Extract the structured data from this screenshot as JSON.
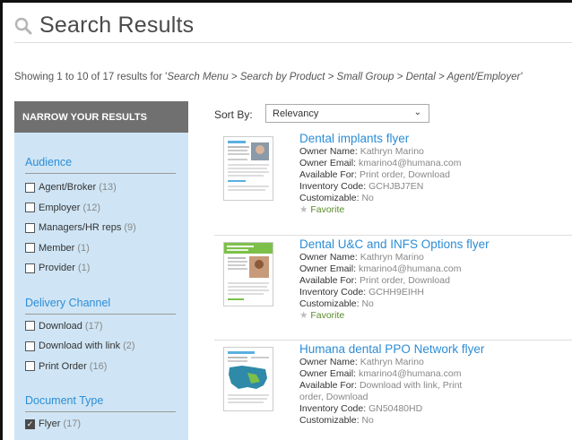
{
  "header": {
    "title": "Search Results"
  },
  "results_summary": {
    "prefix": "Showing 1 to 10 of 17 results for '",
    "crumb": "Search Menu > Search by Product > Small Group > Dental > Agent/Employer'"
  },
  "sidebar": {
    "heading": "NARROW YOUR RESULTS",
    "groups": [
      {
        "title": "Audience",
        "items": [
          {
            "label": "Agent/Broker",
            "count": "(13)",
            "checked": false
          },
          {
            "label": "Employer",
            "count": "(12)",
            "checked": false
          },
          {
            "label": "Managers/HR reps",
            "count": "(9)",
            "checked": false
          },
          {
            "label": "Member",
            "count": "(1)",
            "checked": false
          },
          {
            "label": "Provider",
            "count": "(1)",
            "checked": false
          }
        ]
      },
      {
        "title": "Delivery Channel",
        "items": [
          {
            "label": "Download",
            "count": "(17)",
            "checked": false
          },
          {
            "label": "Download with link",
            "count": "(2)",
            "checked": false
          },
          {
            "label": "Print Order",
            "count": "(16)",
            "checked": false
          }
        ]
      },
      {
        "title": "Document Type",
        "items": [
          {
            "label": "Flyer",
            "count": "(17)",
            "checked": true
          }
        ]
      }
    ]
  },
  "sort": {
    "label": "Sort By:",
    "selected": "Relevancy"
  },
  "results": [
    {
      "title": "Dental implants flyer",
      "owner_name_label": "Owner Name:",
      "owner_name": "Kathryn Marino",
      "owner_email_label": "Owner Email:",
      "owner_email": "kmarino4@humana.com",
      "available_label": "Available For:",
      "available": "Print order, Download",
      "available2": "",
      "inventory_label": "Inventory Code:",
      "inventory": "GCHJBJ7EN",
      "custom_label": "Customizable:",
      "custom": "No",
      "favorite": "Favorite"
    },
    {
      "title": "Dental U&C and INFS Options flyer",
      "owner_name_label": "Owner Name:",
      "owner_name": "Kathryn Marino",
      "owner_email_label": "Owner Email:",
      "owner_email": "kmarino4@humana.com",
      "available_label": "Available For:",
      "available": "Print order, Download",
      "available2": "",
      "inventory_label": "Inventory Code:",
      "inventory": "GCHH9EIHH",
      "custom_label": "Customizable:",
      "custom": "No",
      "favorite": "Favorite"
    },
    {
      "title": "Humana dental PPO Network flyer",
      "owner_name_label": "Owner Name:",
      "owner_name": "Kathryn Marino",
      "owner_email_label": "Owner Email:",
      "owner_email": "kmarino4@humana.com",
      "available_label": "Available For:",
      "available": "Download with link, Print",
      "available2": "order, Download",
      "inventory_label": "Inventory Code:",
      "inventory": "GN50480HD",
      "custom_label": "Customizable:",
      "custom": "No",
      "favorite": ""
    }
  ],
  "colors": {
    "accent": "#2c8dd6",
    "sidebar_bg": "#cfe5f5",
    "sidebar_head": "#707070",
    "favorite": "#5a8a2a"
  }
}
